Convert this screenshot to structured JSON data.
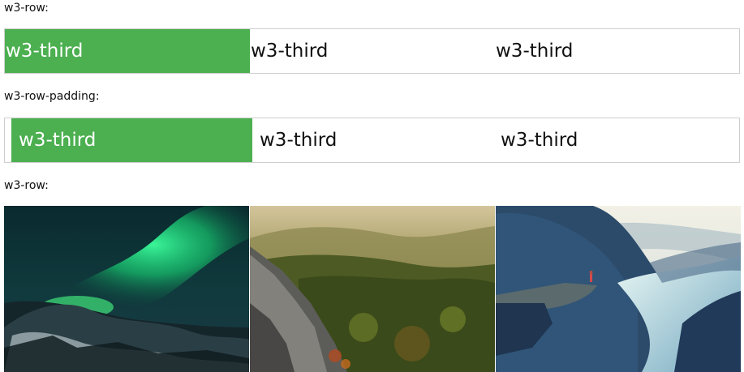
{
  "sections": [
    {
      "caption": "w3-row:",
      "cells": [
        "w3-third",
        "w3-third",
        "w3-third"
      ]
    },
    {
      "caption": "w3-row-padding:",
      "cells": [
        "w3-third",
        "w3-third",
        "w3-third"
      ]
    },
    {
      "caption": "w3-row:",
      "images": [
        "northern-lights-photo",
        "forest-mountains-photo",
        "fjord-cliff-photo"
      ]
    }
  ],
  "colors": {
    "green": "#4caf50",
    "border": "#cfcfcf"
  }
}
